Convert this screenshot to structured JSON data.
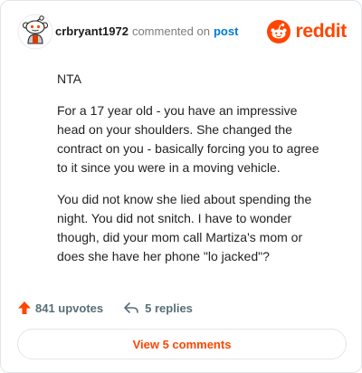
{
  "header": {
    "author": "crbryant1972",
    "action": "commented on",
    "target": "post",
    "brand": "reddit"
  },
  "comment": {
    "paragraphs": [
      "NTA",
      "For a 17 year old - you have an impressive head on your shoulders. She changed the contract on you - basically forcing you to agree to it since you were in a moving vehicle.",
      "You did not know she lied about spending the night. You did not snitch. I have to wonder though, did your mom call Martiza's mom or does she have her phone \"lo jacked\"?"
    ]
  },
  "footer": {
    "upvotes": "841 upvotes",
    "replies": "5 replies",
    "view_button": "View 5 comments"
  },
  "icons": {
    "avatar": "snoo-avatar-icon",
    "brand": "reddit-logo-icon",
    "upvote": "upvote-arrow-icon",
    "reply": "reply-arrow-icon"
  },
  "colors": {
    "accent": "#ff4500",
    "link": "#0079d3",
    "muted": "#576f76"
  }
}
